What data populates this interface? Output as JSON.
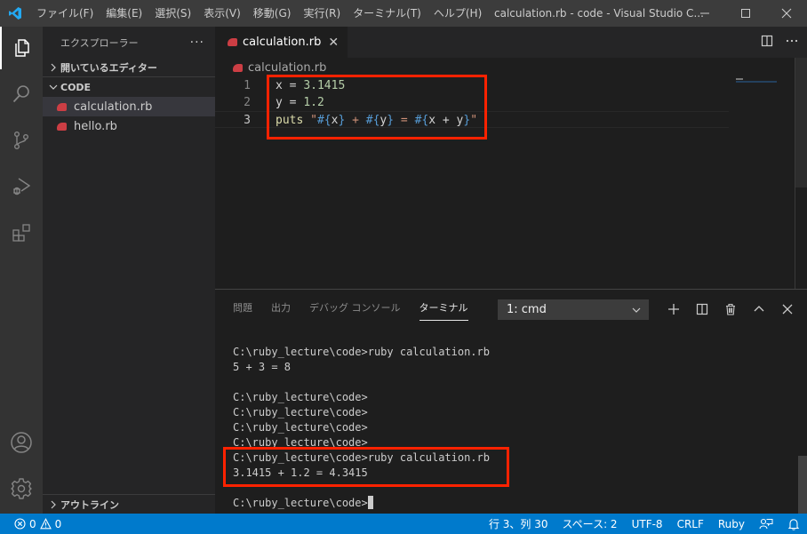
{
  "titlebar": {
    "menu": [
      "ファイル(F)",
      "編集(E)",
      "選択(S)",
      "表示(V)",
      "移動(G)",
      "実行(R)",
      "ターミナル(T)",
      "ヘルプ(H)"
    ],
    "window_title": "calculation.rb - code - Visual Studio C...",
    "minimize": "—",
    "maximize": "☐",
    "close": "✕"
  },
  "activitybar": {
    "icons": [
      "files-icon",
      "search-icon",
      "source-control-icon",
      "run-debug-icon",
      "extensions-icon",
      "account-icon",
      "settings-gear-icon"
    ]
  },
  "sidebar": {
    "title": "エクスプローラー",
    "more": "···",
    "open_editors": "開いているエディター",
    "folder": "CODE",
    "files": [
      {
        "name": "calculation.rb",
        "selected": true
      },
      {
        "name": "hello.rb",
        "selected": false
      }
    ],
    "outline": "アウトライン"
  },
  "editor": {
    "tab": {
      "label": "calculation.rb",
      "close": "✕"
    },
    "breadcrumb": "calculation.rb",
    "lines": [
      {
        "number": "1",
        "text": "x = 3.1415"
      },
      {
        "number": "2",
        "text": "y = 1.2"
      },
      {
        "number": "3",
        "text": "puts \"#{x} + #{y} = #{x + y}\""
      }
    ],
    "tokens": {
      "l1": {
        "var": "x",
        "op": " = ",
        "num": "3.1415"
      },
      "l2": {
        "var": "y",
        "op": " = ",
        "num": "1.2"
      },
      "l3": {
        "fn": "puts",
        "sp": " ",
        "q1": "\"",
        "i1o": "#{",
        "i1v": "x",
        "i1c": "}",
        "s1": " + ",
        "i2o": "#{",
        "i2v": "y",
        "i2c": "}",
        "s2": " = ",
        "i3o": "#{",
        "i3v": "x + y",
        "i3c": "}",
        "q2": "\""
      }
    }
  },
  "panel": {
    "tabs": [
      "問題",
      "出力",
      "デバッグ コンソール",
      "ターミナル"
    ],
    "active_tab": "ターミナル",
    "terminal_select": "1: cmd",
    "terminal_lines": [
      "C:\\ruby_lecture\\code>ruby calculation.rb",
      "5 + 3 = 8",
      "",
      "C:\\ruby_lecture\\code>",
      "C:\\ruby_lecture\\code>",
      "C:\\ruby_lecture\\code>",
      "C:\\ruby_lecture\\code>",
      "C:\\ruby_lecture\\code>ruby calculation.rb",
      "3.1415 + 1.2 = 4.3415",
      "",
      "C:\\ruby_lecture\\code>"
    ]
  },
  "statusbar": {
    "errors": "0",
    "warnings": "0",
    "position": "行 3、列 30",
    "spaces": "スペース: 2",
    "encoding": "UTF-8",
    "eol": "CRLF",
    "language": "Ruby"
  },
  "colors": {
    "accent": "#007acc",
    "highlight_box": "#ff2200",
    "ruby_icon": "#cc3e44"
  }
}
